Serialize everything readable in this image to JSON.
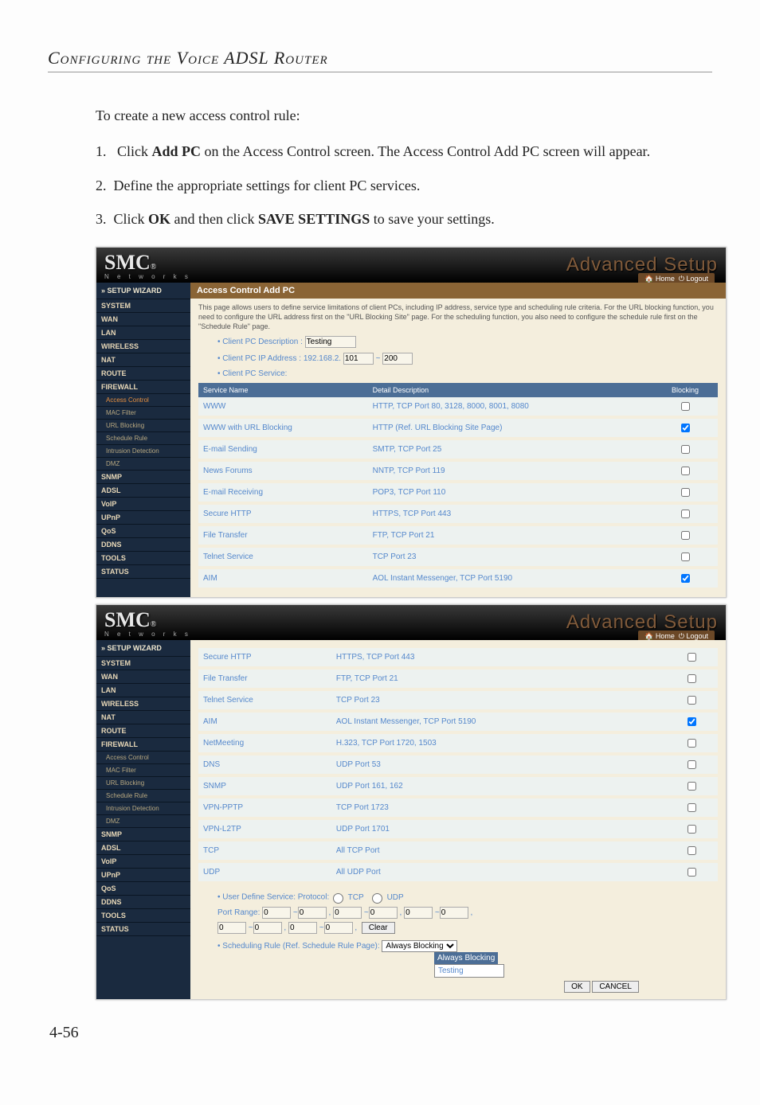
{
  "page": {
    "header": "Configuring the Voice ADSL Router",
    "intro": "To create a new access control rule:",
    "steps": [
      {
        "num": "1.",
        "pre": "Click ",
        "bold": "Add PC",
        "post": " on the Access Control screen. The Access Control Add PC screen will appear."
      },
      {
        "num": "2.",
        "pre": "Define the appropriate settings for client PC services.",
        "bold": "",
        "post": ""
      },
      {
        "num": "3.",
        "pre": "Click ",
        "bold": "OK",
        "mid": " and then click ",
        "bold2": "SAVE SETTINGS",
        "post": " to save your settings."
      }
    ],
    "pagenum": "4-56"
  },
  "ui_common": {
    "logo": "SMC",
    "logo_sub": "N e t w o r k s",
    "brand_title": "Advanced Setup",
    "home": "Home",
    "logout": "Logout"
  },
  "screenshot1": {
    "sidebar": [
      {
        "label": "» SETUP WIZARD",
        "cls": "setup-wiz"
      },
      {
        "label": "SYSTEM"
      },
      {
        "label": "WAN"
      },
      {
        "label": "LAN"
      },
      {
        "label": "WIRELESS"
      },
      {
        "label": "NAT"
      },
      {
        "label": "ROUTE"
      },
      {
        "label": "FIREWALL"
      },
      {
        "label": "Access Control",
        "cls": "sub sub-active"
      },
      {
        "label": "MAC Filter",
        "cls": "sub"
      },
      {
        "label": "URL Blocking",
        "cls": "sub"
      },
      {
        "label": "Schedule Rule",
        "cls": "sub"
      },
      {
        "label": "Intrusion Detection",
        "cls": "sub"
      },
      {
        "label": "DMZ",
        "cls": "sub"
      },
      {
        "label": "SNMP"
      },
      {
        "label": "ADSL"
      },
      {
        "label": "VoIP"
      },
      {
        "label": "UPnP"
      },
      {
        "label": "QoS"
      },
      {
        "label": "DDNS"
      },
      {
        "label": "TOOLS"
      },
      {
        "label": "STATUS"
      }
    ],
    "main_title": "Access Control Add PC",
    "description": "This page allows users to define service limitations of client PCs, including IP address, service type and scheduling rule criteria. For the URL blocking function, you need to configure the URL address first on the \"URL Blocking Site\" page. For the scheduling function, you also need to configure the schedule rule first on the \"Schedule Rule\" page.",
    "fields": {
      "desc_label": "Client PC Description :",
      "desc_value": "Testing",
      "ip_label": "Client PC IP Address :",
      "ip_prefix": "192.168.2.",
      "ip_from": "101",
      "ip_to": "200",
      "svc_label": "Client PC Service:"
    },
    "table": {
      "headers": [
        "Service Name",
        "Detail Description",
        "Blocking"
      ],
      "rows": [
        {
          "name": "WWW",
          "desc": "HTTP, TCP Port 80, 3128, 8000, 8001, 8080",
          "chk": false
        },
        {
          "name": "WWW with URL Blocking",
          "desc": "HTTP (Ref. URL Blocking Site Page)",
          "chk": true
        },
        {
          "name": "E-mail Sending",
          "desc": "SMTP, TCP Port 25",
          "chk": false
        },
        {
          "name": "News Forums",
          "desc": "NNTP, TCP Port 119",
          "chk": false
        },
        {
          "name": "E-mail Receiving",
          "desc": "POP3, TCP Port 110",
          "chk": false
        },
        {
          "name": "Secure HTTP",
          "desc": "HTTPS, TCP Port 443",
          "chk": false
        },
        {
          "name": "File Transfer",
          "desc": "FTP, TCP Port 21",
          "chk": false
        },
        {
          "name": "Telnet Service",
          "desc": "TCP Port 23",
          "chk": false
        },
        {
          "name": "AIM",
          "desc": "AOL Instant Messenger, TCP Port 5190",
          "chk": true
        }
      ]
    }
  },
  "screenshot2": {
    "sidebar": [
      {
        "label": "» SETUP WIZARD",
        "cls": "setup-wiz"
      },
      {
        "label": "SYSTEM"
      },
      {
        "label": "WAN"
      },
      {
        "label": "LAN"
      },
      {
        "label": "WIRELESS"
      },
      {
        "label": "NAT"
      },
      {
        "label": "ROUTE"
      },
      {
        "label": "FIREWALL"
      },
      {
        "label": "Access Control",
        "cls": "sub"
      },
      {
        "label": "MAC Filter",
        "cls": "sub"
      },
      {
        "label": "URL Blocking",
        "cls": "sub"
      },
      {
        "label": "Schedule Rule",
        "cls": "sub"
      },
      {
        "label": "Intrusion Detection",
        "cls": "sub"
      },
      {
        "label": "DMZ",
        "cls": "sub"
      },
      {
        "label": "SNMP"
      },
      {
        "label": "ADSL"
      },
      {
        "label": "VoIP"
      },
      {
        "label": "UPnP"
      },
      {
        "label": "QoS"
      },
      {
        "label": "DDNS"
      },
      {
        "label": "TOOLS"
      },
      {
        "label": "STATUS"
      }
    ],
    "table": {
      "rows": [
        {
          "name": "Secure HTTP",
          "desc": "HTTPS, TCP Port 443",
          "chk": false
        },
        {
          "name": "File Transfer",
          "desc": "FTP, TCP Port 21",
          "chk": false
        },
        {
          "name": "Telnet Service",
          "desc": "TCP Port 23",
          "chk": false
        },
        {
          "name": "AIM",
          "desc": "AOL Instant Messenger, TCP Port 5190",
          "chk": true
        },
        {
          "name": "NetMeeting",
          "desc": "H.323, TCP Port 1720, 1503",
          "chk": false
        },
        {
          "name": "DNS",
          "desc": "UDP Port 53",
          "chk": false
        },
        {
          "name": "SNMP",
          "desc": "UDP Port 161, 162",
          "chk": false
        },
        {
          "name": "VPN-PPTP",
          "desc": "TCP Port 1723",
          "chk": false
        },
        {
          "name": "VPN-L2TP",
          "desc": "UDP Port 1701",
          "chk": false
        },
        {
          "name": "TCP",
          "desc": "All TCP Port",
          "chk": false
        },
        {
          "name": "UDP",
          "desc": "All UDP Port",
          "chk": false
        }
      ]
    },
    "user_define": {
      "label": "User Define Service: Protocol:",
      "tcp": "TCP",
      "udp": "UDP",
      "port_range_label": "Port Range:",
      "values": [
        "0",
        "0",
        "0",
        "0",
        "0",
        "0",
        "0",
        "0",
        "0",
        "0"
      ],
      "clear": "Clear"
    },
    "scheduling": {
      "label": "Scheduling Rule (Ref. Schedule Rule Page):",
      "selected": "Always Blocking",
      "options": [
        "Always Blocking",
        "Testing"
      ]
    },
    "buttons": {
      "ok": "OK",
      "cancel": "CANCEL"
    }
  }
}
